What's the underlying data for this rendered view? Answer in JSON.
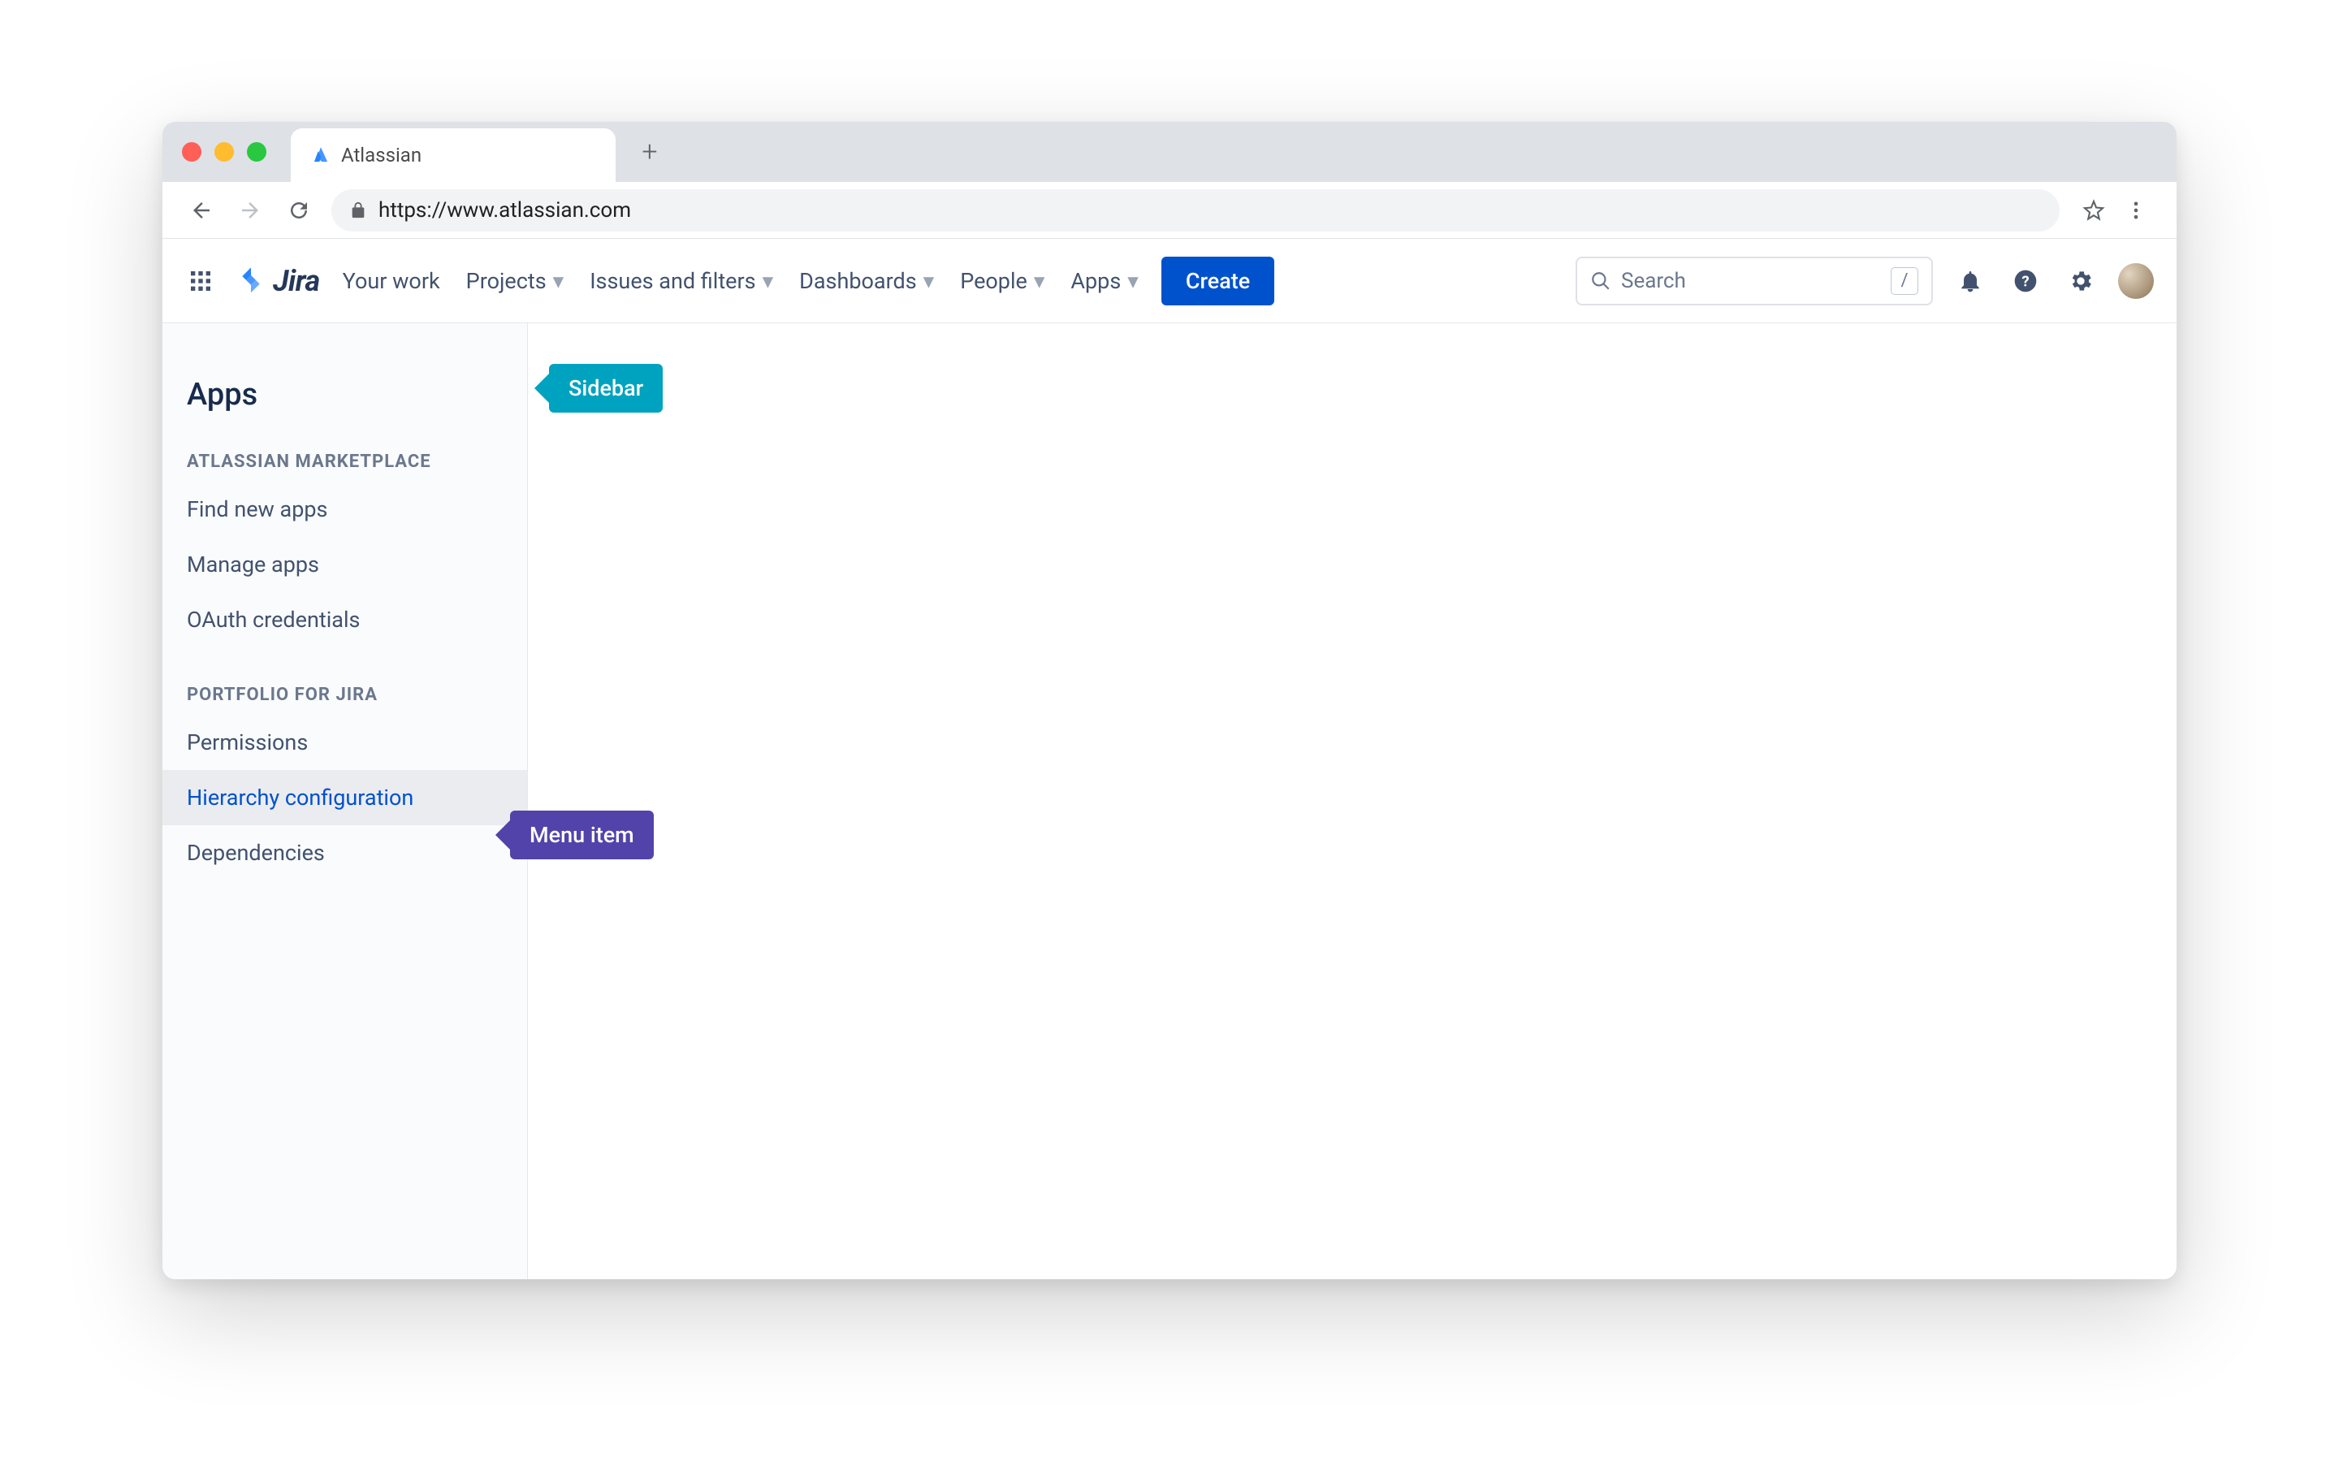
{
  "browser": {
    "tab_title": "Atlassian",
    "url": "https://www.atlassian.com"
  },
  "topnav": {
    "product_name": "Jira",
    "items": [
      "Your work",
      "Projects",
      "Issues and filters",
      "Dashboards",
      "People",
      "Apps"
    ],
    "create_label": "Create",
    "search_placeholder": "Search",
    "search_hint": "/"
  },
  "sidebar": {
    "title": "Apps",
    "sections": [
      {
        "heading": "ATLASSIAN MARKETPLACE",
        "items": [
          "Find new apps",
          "Manage apps",
          "OAuth credentials"
        ]
      },
      {
        "heading": "PORTFOLIO FOR JIRA",
        "items": [
          "Permissions",
          "Hierarchy configuration",
          "Dependencies"
        ],
        "active_index": 1
      }
    ]
  },
  "callouts": {
    "sidebar": "Sidebar",
    "menu_item": "Menu item"
  }
}
